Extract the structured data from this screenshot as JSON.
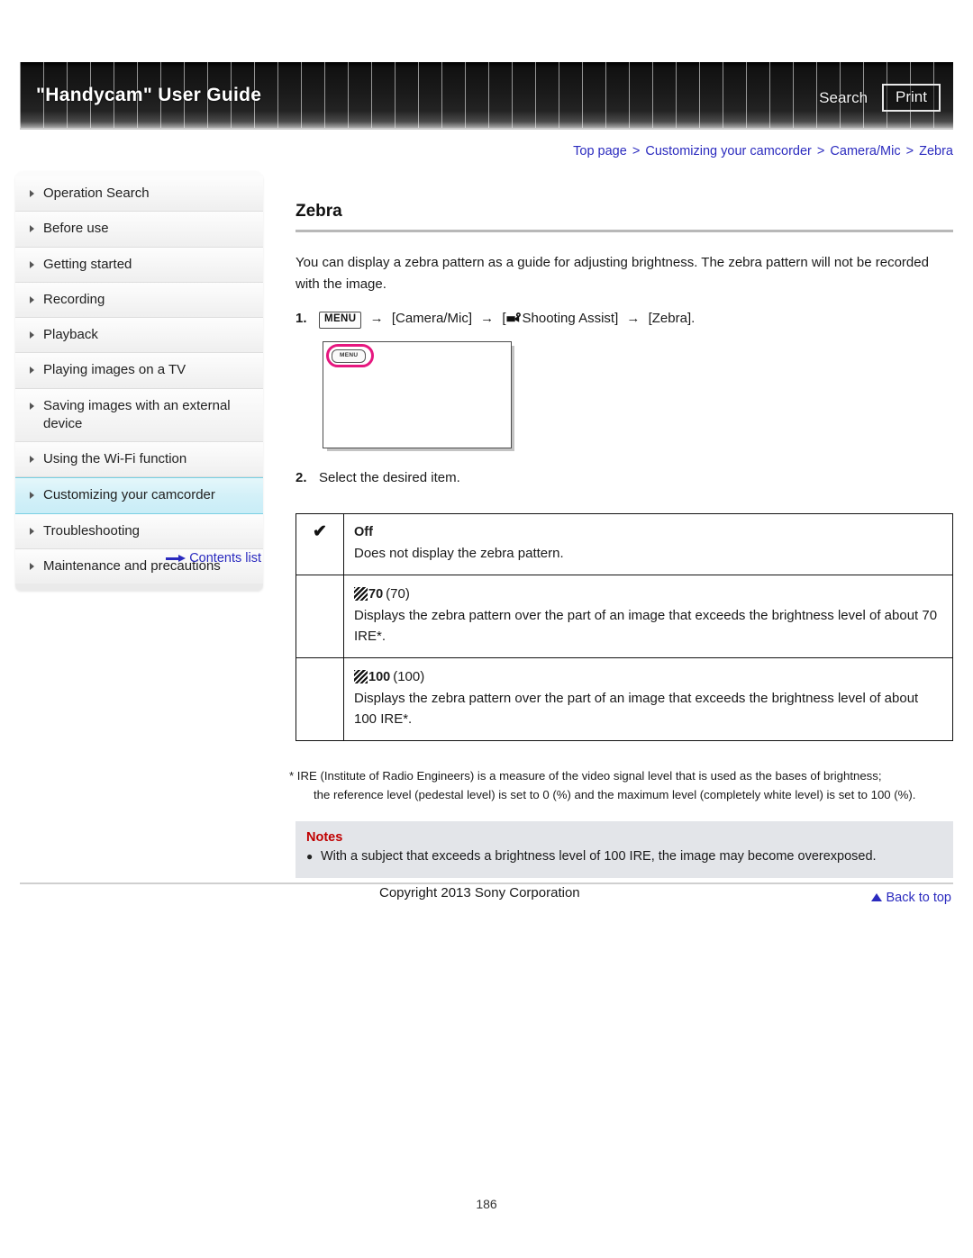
{
  "header": {
    "title": "\"Handycam\" User Guide",
    "search_label": "Search",
    "print_label": "Print"
  },
  "breadcrumb": {
    "items": [
      "Top page",
      "Customizing your camcorder",
      "Camera/Mic",
      "Zebra"
    ],
    "separator": ">"
  },
  "sidebar": {
    "items": [
      {
        "label": "Operation Search",
        "active": false
      },
      {
        "label": "Before use",
        "active": false
      },
      {
        "label": "Getting started",
        "active": false
      },
      {
        "label": "Recording",
        "active": false
      },
      {
        "label": "Playback",
        "active": false
      },
      {
        "label": "Playing images on a TV",
        "active": false
      },
      {
        "label": "Saving images with an external device",
        "active": false
      },
      {
        "label": "Using the Wi-Fi function",
        "active": false
      },
      {
        "label": "Customizing your camcorder",
        "active": true
      },
      {
        "label": "Troubleshooting",
        "active": false
      },
      {
        "label": "Maintenance and precautions",
        "active": false
      }
    ],
    "contents_link": "Contents list"
  },
  "main": {
    "title": "Zebra",
    "intro": "You can display a zebra pattern as a guide for adjusting brightness. The zebra pattern will not be recorded with the image.",
    "step1": {
      "number": "1.",
      "menu_chip": "MENU",
      "arrow": "→",
      "part_camera_mic": "[Camera/Mic]",
      "part_shooting_assist_open": "[",
      "part_shooting_assist": "Shooting Assist]",
      "part_zebra": "[Zebra]."
    },
    "illustration": {
      "menu_chip": "MENU"
    },
    "step2": {
      "number": "2.",
      "text": "Select the desired item."
    },
    "options": [
      {
        "checked": true,
        "check_glyph": "✔",
        "icon": "none",
        "name": "Off",
        "paren": "",
        "description": "Does not display the zebra pattern."
      },
      {
        "checked": false,
        "check_glyph": "",
        "icon": "zebra-pattern",
        "name": "70",
        "paren": "(70)",
        "description": "Displays the zebra pattern over the part of an image that exceeds the brightness level of about 70 IRE*."
      },
      {
        "checked": false,
        "check_glyph": "",
        "icon": "zebra-pattern",
        "name": "100",
        "paren": "(100)",
        "description": "Displays the zebra pattern over the part of an image that exceeds the brightness level of about 100 IRE*."
      }
    ],
    "footnote_first": "* IRE (Institute of Radio Engineers) is a measure of the video signal level that is used as the bases of brightness;",
    "footnote_rest": "the reference level (pedestal level) is set to 0 (%) and the maximum level (completely white level) is set to 100 (%).",
    "notes": {
      "title": "Notes",
      "bullet_glyph": "●",
      "items": [
        "With a subject that exceeds a brightness level of 100 IRE, the image may become overexposed."
      ]
    },
    "back_to_top": "Back to top"
  },
  "footer": {
    "copyright": "Copyright 2013 Sony Corporation",
    "page_number": "186"
  },
  "colors": {
    "link": "#2b2bbf",
    "notes_title": "#c00000",
    "highlight_ring": "#e6177f",
    "sidebar_active": "#d2f0f8"
  }
}
